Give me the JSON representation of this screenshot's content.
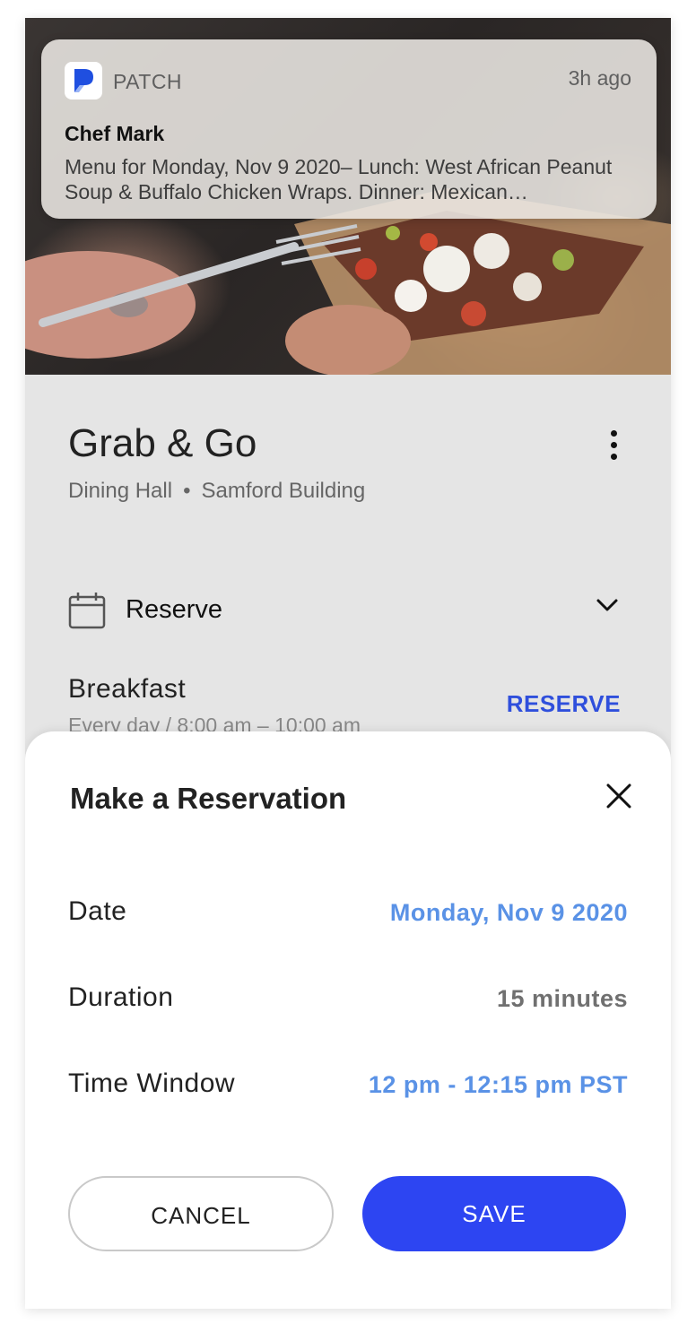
{
  "notification": {
    "app_name": "PATCH",
    "time": "3h ago",
    "title": "Chef Mark",
    "body": "Menu for Monday, Nov 9 2020– Lunch: West African Peanut Soup & Buffalo Chicken Wraps. Dinner: Mexican…"
  },
  "venue": {
    "title": "Grab & Go",
    "type": "Dining Hall",
    "separator": "•",
    "building": "Samford Building"
  },
  "reserve_section": {
    "label": "Reserve"
  },
  "meal": {
    "name": "Breakfast",
    "hours": "Every day / 8:00 am – 10:00 am",
    "action": "RESERVE"
  },
  "dialog": {
    "title": "Make a Reservation",
    "rows": [
      {
        "label": "Date",
        "value": "Monday, Nov 9 2020"
      },
      {
        "label": "Duration",
        "value": "15 minutes"
      },
      {
        "label": "Time Window",
        "value": "12 pm - 12:15 pm PST"
      }
    ],
    "cancel_label": "CANCEL",
    "save_label": "SAVE"
  },
  "colors": {
    "accent": "#2d45f2",
    "link_blue": "#5a92e6",
    "reserve_blue": "#2f4fdc"
  }
}
